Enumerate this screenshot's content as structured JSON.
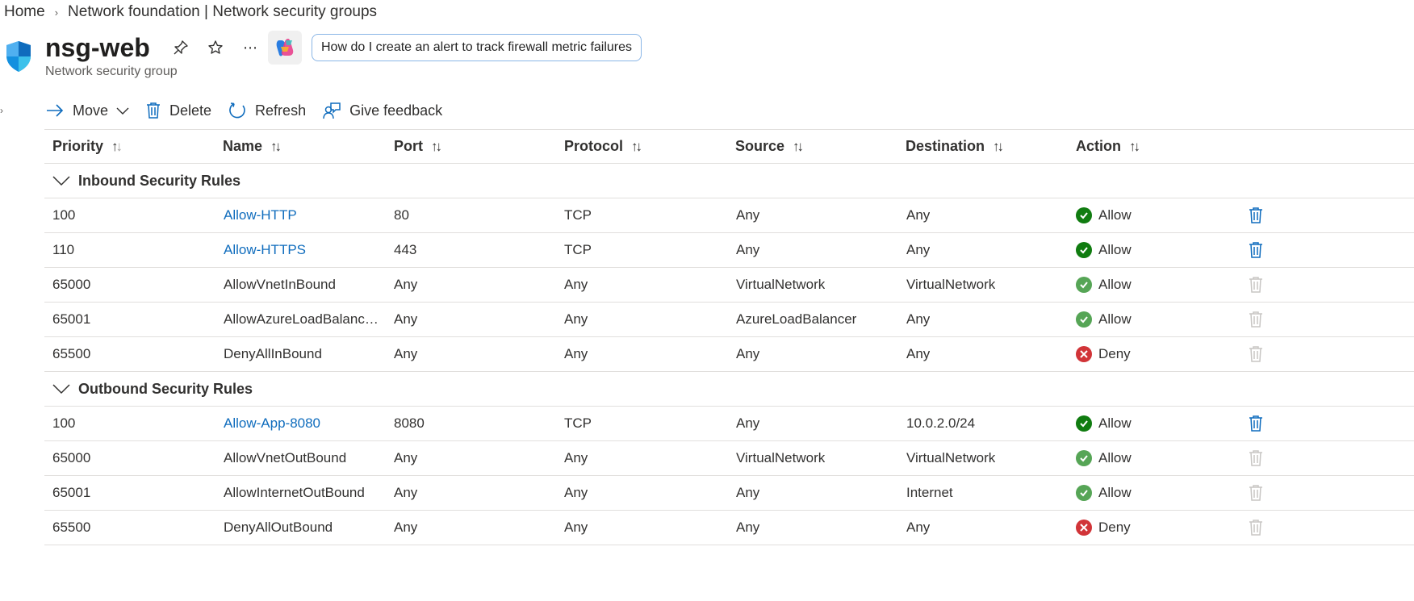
{
  "breadcrumb": {
    "home": "Home",
    "current": "Network foundation | Network security groups"
  },
  "header": {
    "title": "nsg-web",
    "subtitle": "Network security group",
    "copilot_prompt": "How do I create an alert to track firewall metric failures"
  },
  "toolbar": {
    "move": "Move",
    "delete": "Delete",
    "refresh": "Refresh",
    "feedback": "Give feedback"
  },
  "columns": [
    "Priority",
    "Name",
    "Port",
    "Protocol",
    "Source",
    "Destination",
    "Action"
  ],
  "groups": [
    {
      "label": "Inbound Security Rules",
      "rows": [
        {
          "priority": "100",
          "name": "Allow-HTTP",
          "port": "80",
          "protocol": "TCP",
          "source": "Any",
          "destination": "Any",
          "action": "Allow",
          "custom": true
        },
        {
          "priority": "110",
          "name": "Allow-HTTPS",
          "port": "443",
          "protocol": "TCP",
          "source": "Any",
          "destination": "Any",
          "action": "Allow",
          "custom": true
        },
        {
          "priority": "65000",
          "name": "AllowVnetInBound",
          "port": "Any",
          "protocol": "Any",
          "source": "VirtualNetwork",
          "destination": "VirtualNetwork",
          "action": "Allow",
          "custom": false
        },
        {
          "priority": "65001",
          "name": "AllowAzureLoadBalancerInBound",
          "port": "Any",
          "protocol": "Any",
          "source": "AzureLoadBalancer",
          "destination": "Any",
          "action": "Allow",
          "custom": false
        },
        {
          "priority": "65500",
          "name": "DenyAllInBound",
          "port": "Any",
          "protocol": "Any",
          "source": "Any",
          "destination": "Any",
          "action": "Deny",
          "custom": false
        }
      ]
    },
    {
      "label": "Outbound Security Rules",
      "rows": [
        {
          "priority": "100",
          "name": "Allow-App-8080",
          "port": "8080",
          "protocol": "TCP",
          "source": "Any",
          "destination": "10.0.2.0/24",
          "action": "Allow",
          "custom": true
        },
        {
          "priority": "65000",
          "name": "AllowVnetOutBound",
          "port": "Any",
          "protocol": "Any",
          "source": "VirtualNetwork",
          "destination": "VirtualNetwork",
          "action": "Allow",
          "custom": false
        },
        {
          "priority": "65001",
          "name": "AllowInternetOutBound",
          "port": "Any",
          "protocol": "Any",
          "source": "Any",
          "destination": "Internet",
          "action": "Allow",
          "custom": false
        },
        {
          "priority": "65500",
          "name": "DenyAllOutBound",
          "port": "Any",
          "protocol": "Any",
          "source": "Any",
          "destination": "Any",
          "action": "Deny",
          "custom": false
        }
      ]
    }
  ],
  "colors": {
    "accent": "#0f6cbd",
    "allow": "#107c10",
    "deny": "#d13438",
    "border": "#e1dfdd"
  }
}
